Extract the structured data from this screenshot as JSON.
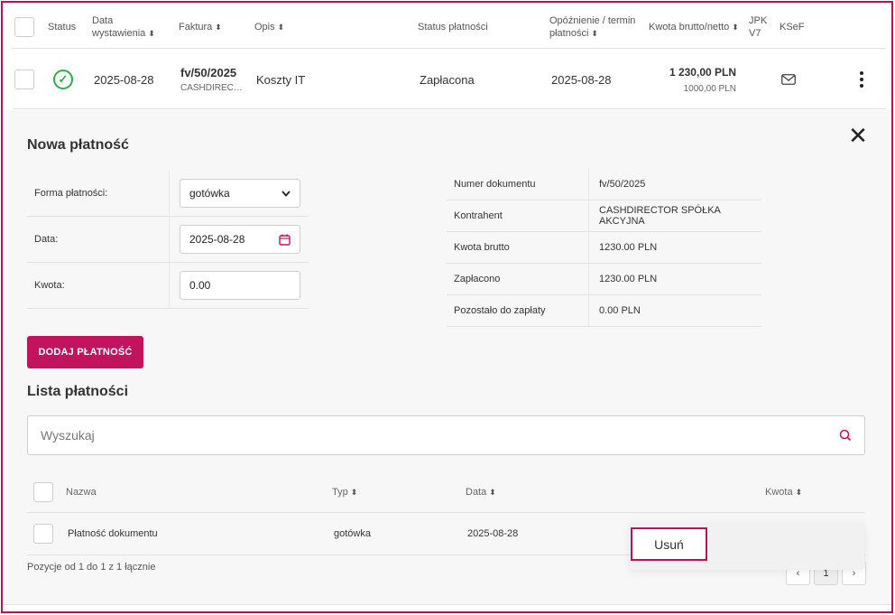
{
  "table": {
    "headers": {
      "status": "Status",
      "date_line1": "Data",
      "date_line2": "wystawienia",
      "invoice": "Faktura",
      "description": "Opis",
      "payment_status": "Status płatności",
      "delay_line1": "Opóźnienie / termin",
      "delay_line2": "płatności",
      "amount": "Kwota brutto/netto",
      "jpk_line1": "JPK",
      "jpk_line2": "V7",
      "ksef": "KSeF"
    },
    "row": {
      "date": "2025-08-28",
      "invoice_number": "fv/50/2025",
      "contractor_short": "CASHDIREC…",
      "description": "Koszty IT",
      "payment_status": "Zapłacona",
      "due_date": "2025-08-28",
      "gross": "1 230,00 PLN",
      "net": "1000,00 PLN"
    }
  },
  "new_payment": {
    "title": "Nowa płatność",
    "form": {
      "method_label": "Forma płatności:",
      "method_value": "gotówka",
      "date_label": "Data:",
      "date_value": "2025-08-28",
      "amount_label": "Kwota:",
      "amount_value": "0.00"
    },
    "info": [
      {
        "key": "Numer dokumentu",
        "value": "fv/50/2025"
      },
      {
        "key": "Kontrahent",
        "value": "CASHDIRECTOR SPÓŁKA AKCYJNA"
      },
      {
        "key": "Kwota brutto",
        "value": "1230.00 PLN"
      },
      {
        "key": "Zapłacono",
        "value": "1230.00 PLN"
      },
      {
        "key": "Pozostało do zapłaty",
        "value": "0.00 PLN"
      }
    ],
    "add_button": "DODAJ PŁATNOŚĆ"
  },
  "payments_list": {
    "title": "Lista płatności",
    "search_placeholder": "Wyszukaj",
    "headers": {
      "name": "Nazwa",
      "type": "Typ",
      "date": "Data",
      "amount": "Kwota"
    },
    "rows": [
      {
        "name": "Płatność dokumentu",
        "type": "gotówka",
        "date": "2025-08-28"
      }
    ],
    "context_menu": {
      "delete": "Usuń"
    },
    "pagination": {
      "info": "Pozycje od 1 do 1 z 1 łącznie",
      "current_page": "1"
    }
  },
  "colors": {
    "accent": "#c2135e",
    "success": "#2eae4b"
  }
}
